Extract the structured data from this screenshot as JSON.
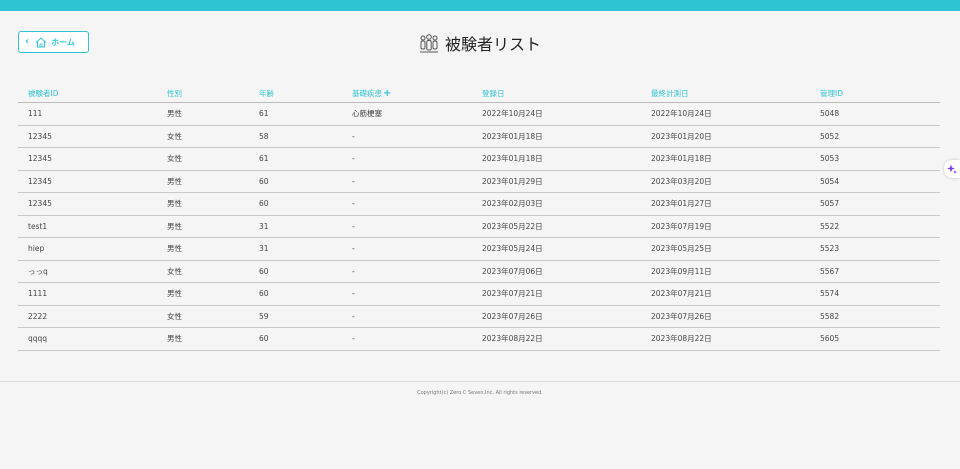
{
  "header": {
    "home_label": "ホーム",
    "title": "被験者リスト"
  },
  "table": {
    "columns": [
      "被験者ID",
      "性別",
      "年齢",
      "基礎疾患",
      "登録日",
      "最終計測日",
      "管理ID"
    ],
    "add_disease_symbol": "+",
    "rows": [
      [
        "111",
        "男性",
        "61",
        "心筋梗塞",
        "2022年10月24日",
        "2022年10月24日",
        "5048"
      ],
      [
        "12345",
        "女性",
        "58",
        "-",
        "2023年01月18日",
        "2023年01月20日",
        "5052"
      ],
      [
        "12345",
        "女性",
        "61",
        "-",
        "2023年01月18日",
        "2023年01月18日",
        "5053"
      ],
      [
        "12345",
        "男性",
        "60",
        "-",
        "2023年01月29日",
        "2023年03月20日",
        "5054"
      ],
      [
        "12345",
        "男性",
        "60",
        "-",
        "2023年02月03日",
        "2023年01月27日",
        "5057"
      ],
      [
        "test1",
        "男性",
        "31",
        "-",
        "2023年05月22日",
        "2023年07月19日",
        "5522"
      ],
      [
        "hiep",
        "男性",
        "31",
        "-",
        "2023年05月24日",
        "2023年05月25日",
        "5523"
      ],
      [
        "っっq",
        "女性",
        "60",
        "-",
        "2023年07月06日",
        "2023年09月11日",
        "5567"
      ],
      [
        "1111",
        "男性",
        "60",
        "-",
        "2023年07月21日",
        "2023年07月21日",
        "5574"
      ],
      [
        "2222",
        "女性",
        "59",
        "-",
        "2023年07月26日",
        "2023年07月26日",
        "5582"
      ],
      [
        "qqqq",
        "男性",
        "60",
        "-",
        "2023年08月22日",
        "2023年08月22日",
        "5605"
      ]
    ]
  },
  "footer": {
    "copyright": "Copyright(c) Zero C Seven,Inc. All rights reserved."
  },
  "colors": {
    "accent": "#2ec4d4",
    "sparkle": "#7b3fe4"
  },
  "icons": {
    "back": "chevron-left-icon",
    "home": "home-icon",
    "title": "people-group-icon",
    "assistant": "sparkle-icon"
  }
}
